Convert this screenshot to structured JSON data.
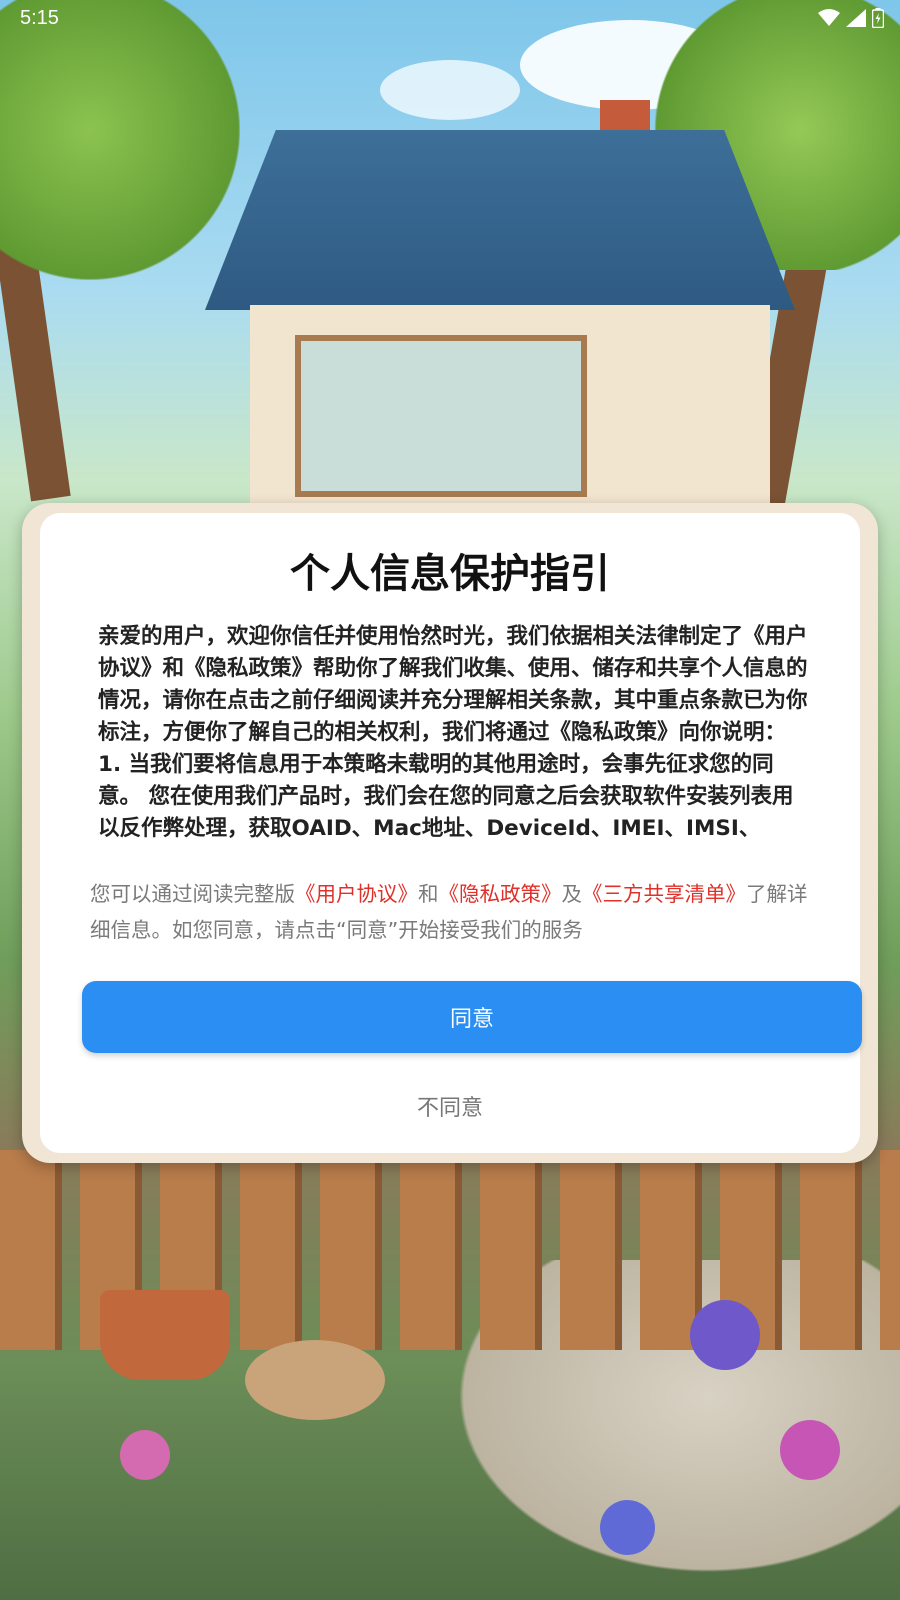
{
  "status_bar": {
    "time": "5:15",
    "icons": [
      "wifi-icon",
      "signal-icon",
      "battery-icon"
    ]
  },
  "dialog": {
    "title": "个人信息保护指引",
    "body_paragraph_1": "亲爱的用户，欢迎你信任并使用怡然时光，我们依据相关法律制定了《用户协议》和《隐私政策》帮助你了解我们收集、使用、储存和共享个人信息的情况，请你在点击之前仔细阅读并充分理解相关条款，其中重点条款已为你标注，方便你了解自己的相关权利，我们将通过《隐私政策》向你说明：",
    "body_paragraph_2": "1. 当我们要将信息用于本策略未载明的其他用途时，会事先征求您的同意。 您在使用我们产品时，我们会在您的同意之后会获取软件安装列表用以反作弊处理，获取OAID、Mac地址、DeviceId、IMEI、IMSI、",
    "note": {
      "prefix": "您可以通过阅读完整版",
      "link_user_agreement": "《用户协议》",
      "and": "和",
      "link_privacy_policy": "《隐私政策》",
      "and2": "及",
      "link_third_party_list": "《三方共享清单》",
      "suffix": "了解详细信息。如您同意，请点击“同意”开始接受我们的服务"
    },
    "agree_label": "同意",
    "disagree_label": "不同意"
  },
  "colors": {
    "agree_button": "#2b8ef3",
    "link": "#e0302a",
    "dialog_frame": "#f1e6d6"
  }
}
